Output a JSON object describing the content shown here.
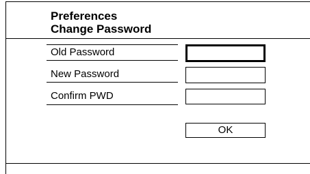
{
  "dialog": {
    "title_line1": "Preferences",
    "title_line2": "Change Password"
  },
  "fields": {
    "old_password_label": "Old Password",
    "new_password_label": "New Password",
    "confirm_label": "Confirm PWD",
    "old_password_value": "",
    "new_password_value": "",
    "confirm_value": ""
  },
  "buttons": {
    "ok_label": "OK"
  }
}
